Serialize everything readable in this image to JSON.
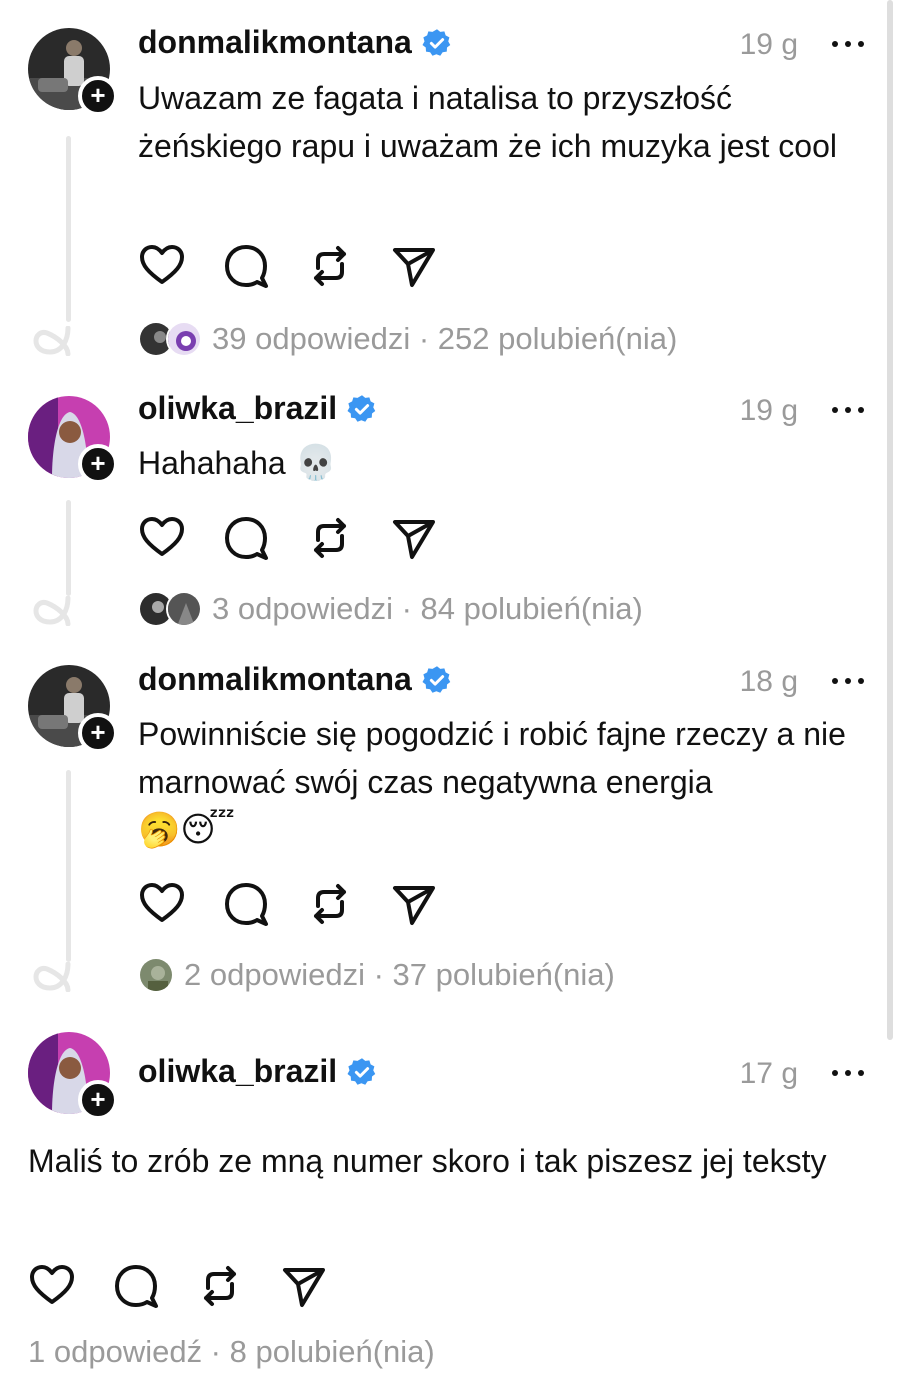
{
  "posts": [
    {
      "username": "donmalikmontana",
      "time": "19 g",
      "text": "Uwazam ze fagata i natalisa to przyszłość żeńskiego rapu i uważam że ich muzyka jest cool",
      "emoji": "",
      "stats": "39 odpowiedzi · 252 polubień(nia)"
    },
    {
      "username": "oliwka_brazil",
      "time": "19 g",
      "text": "Hahahaha ",
      "emoji": "💀",
      "stats": "3 odpowiedzi · 84 polubień(nia)"
    },
    {
      "username": "donmalikmontana",
      "time": "18 g",
      "text": "Powinniście się pogodzić i robić fajne rzeczy a nie marnować swój czas negatywna energia",
      "emoji": "🥱😴",
      "stats": "2 odpowiedzi · 37 polubień(nia)"
    },
    {
      "username": "oliwka_brazil",
      "time": "17 g",
      "text": "Maliś to zrób ze mną numer skoro i tak piszesz jej teksty",
      "emoji": "",
      "stats": "1 odpowiedź · 8 polubień(nia)"
    }
  ],
  "icons": {
    "verified": "verified-badge-icon",
    "like": "heart-icon",
    "reply": "comment-icon",
    "repost": "repost-icon",
    "share": "send-icon",
    "more": "more-horizontal-icon",
    "follow": "plus-icon"
  },
  "colors": {
    "verified": "#3b96f2",
    "muted": "#9a9a9a",
    "thread_line": "#e6e6e6"
  }
}
